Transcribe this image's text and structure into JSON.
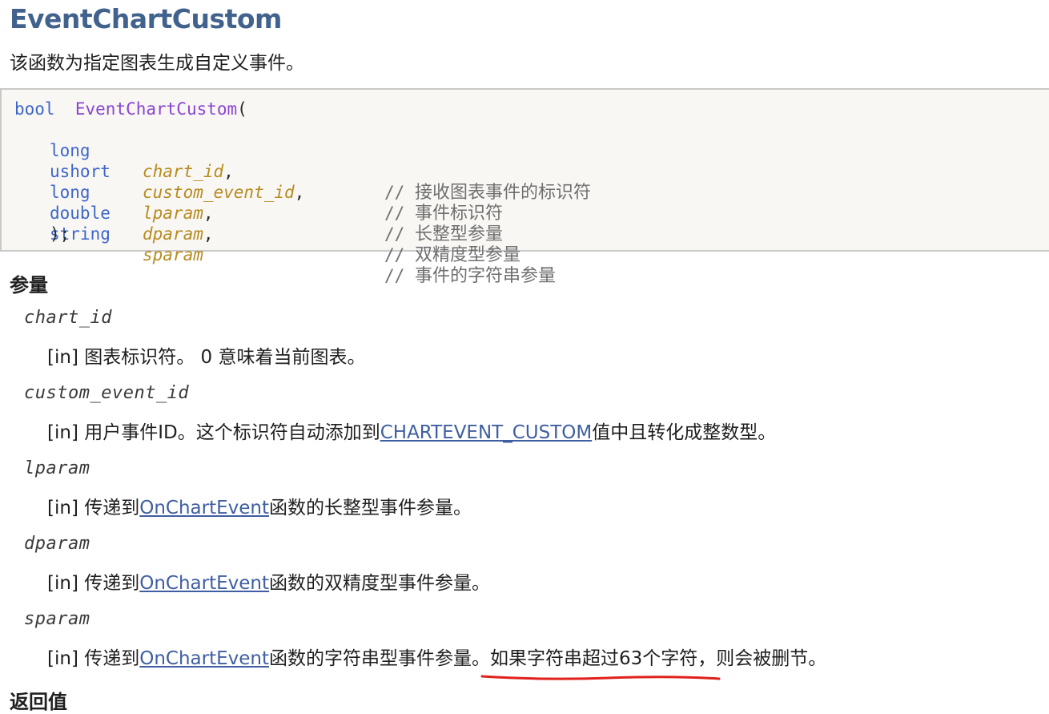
{
  "title": "EventChartCustom",
  "description": "该函数为指定图表生成自定义事件。",
  "code": {
    "return_type": "bool",
    "function_name": "EventChartCustom",
    "open_paren": "(",
    "close": ");",
    "params": [
      {
        "type": "long",
        "name": "chart_id",
        "suffix": ",",
        "comment_mark": "//",
        "comment": "接收图表事件的标识符"
      },
      {
        "type": "ushort",
        "name": "custom_event_id",
        "suffix": ",",
        "comment_mark": "//",
        "comment": "事件标识符"
      },
      {
        "type": "long",
        "name": "lparam",
        "suffix": ",",
        "comment_mark": "//",
        "comment": "长整型参量"
      },
      {
        "type": "double",
        "name": "dparam",
        "suffix": ",",
        "comment_mark": "//",
        "comment": "双精度型参量"
      },
      {
        "type": "string",
        "name": "sparam",
        "suffix": "",
        "comment_mark": "//",
        "comment": "事件的字符串参量"
      }
    ]
  },
  "parameters_heading": "参量",
  "parameters": [
    {
      "name": "chart_id",
      "prefix": "[in] 图表标识符。 0 意味着当前图表。",
      "link": "",
      "suffix": "",
      "highlight": "",
      "tail": ""
    },
    {
      "name": "custom_event_id",
      "prefix": "[in] 用户事件ID。这个标识符自动添加到",
      "link": "CHARTEVENT_CUSTOM",
      "suffix": "值中且转化成整数型。",
      "highlight": "",
      "tail": ""
    },
    {
      "name": "lparam",
      "prefix": "[in] 传递到",
      "link": "OnChartEvent",
      "suffix": "函数的长整型事件参量。",
      "highlight": "",
      "tail": ""
    },
    {
      "name": "dparam",
      "prefix": "[in] 传递到",
      "link": "OnChartEvent",
      "suffix": "函数的双精度型事件参量。",
      "highlight": "",
      "tail": ""
    },
    {
      "name": "sparam",
      "prefix": "[in] 传递到",
      "link": "OnChartEvent",
      "suffix": "函数的字符串型事件参量。",
      "highlight": "如果字符串超过63个字符",
      "tail": "，则会被删节。"
    }
  ],
  "next_heading": "返回值",
  "colors": {
    "title": "#42628e",
    "link": "#3f5ea1",
    "keyword": "#3d66c9",
    "function": "#8a44d0",
    "argument": "#b78b20",
    "annotation": "#e0201b"
  }
}
